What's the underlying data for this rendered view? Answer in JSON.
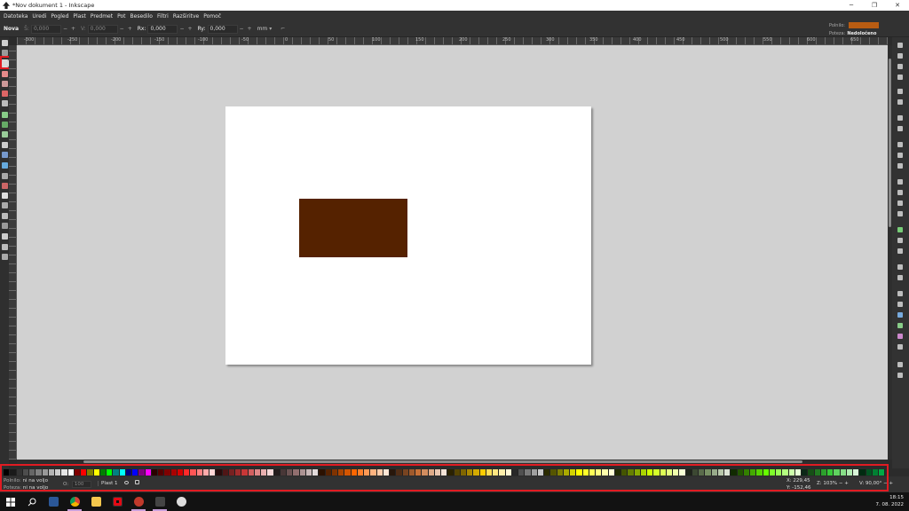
{
  "window": {
    "title": "*Nov dokument 1 - Inkscape",
    "minimize": "─",
    "restore": "❐",
    "close": "✕"
  },
  "menu": [
    "Datoteka",
    "Uredi",
    "Pogled",
    "Plast",
    "Predmet",
    "Pot",
    "Besedilo",
    "Filtri",
    "Razširitve",
    "Pomoč"
  ],
  "controls": {
    "mode_label": "Nova",
    "w_label": "Š:",
    "w_value": "0,000",
    "h_label": "V:",
    "h_value": "0,000",
    "rx_label": "Rx:",
    "rx_value": "0,000",
    "ry_label": "Ry:",
    "ry_value": "0,000",
    "unit": "mm"
  },
  "style_indicator": {
    "fill_label": "Polnilo:",
    "fill_color": "#b85c12",
    "stroke_label": "Poteza:",
    "stroke_value": "Nedoločeno"
  },
  "ruler_labels": [
    "-300",
    "-250",
    "-200",
    "-150",
    "-100",
    "-50",
    "0",
    "50",
    "100",
    "150",
    "200",
    "250",
    "300",
    "350",
    "400",
    "450",
    "500",
    "550",
    "600",
    "650"
  ],
  "canvas": {
    "rectangle_color": "#552200"
  },
  "status": {
    "fill_label": "Polnilo:",
    "fill_value": "ni na voljo",
    "stroke_label": "Poteza:",
    "stroke_value": "ni na voljo",
    "opacity_label": "O:",
    "opacity_value": "100",
    "layer": "Plast 1",
    "x_label": "X:",
    "x_value": "229,45",
    "y_label": "Y:",
    "y_value": "-152,46",
    "zoom_label": "Z:",
    "zoom_value": "103%",
    "rotation_label": "V:",
    "rotation_value": "90,00°"
  },
  "clock": {
    "time": "18:15",
    "date": "7. 08. 2022"
  },
  "colors": {
    "accent_highlight": "#e11b22"
  }
}
